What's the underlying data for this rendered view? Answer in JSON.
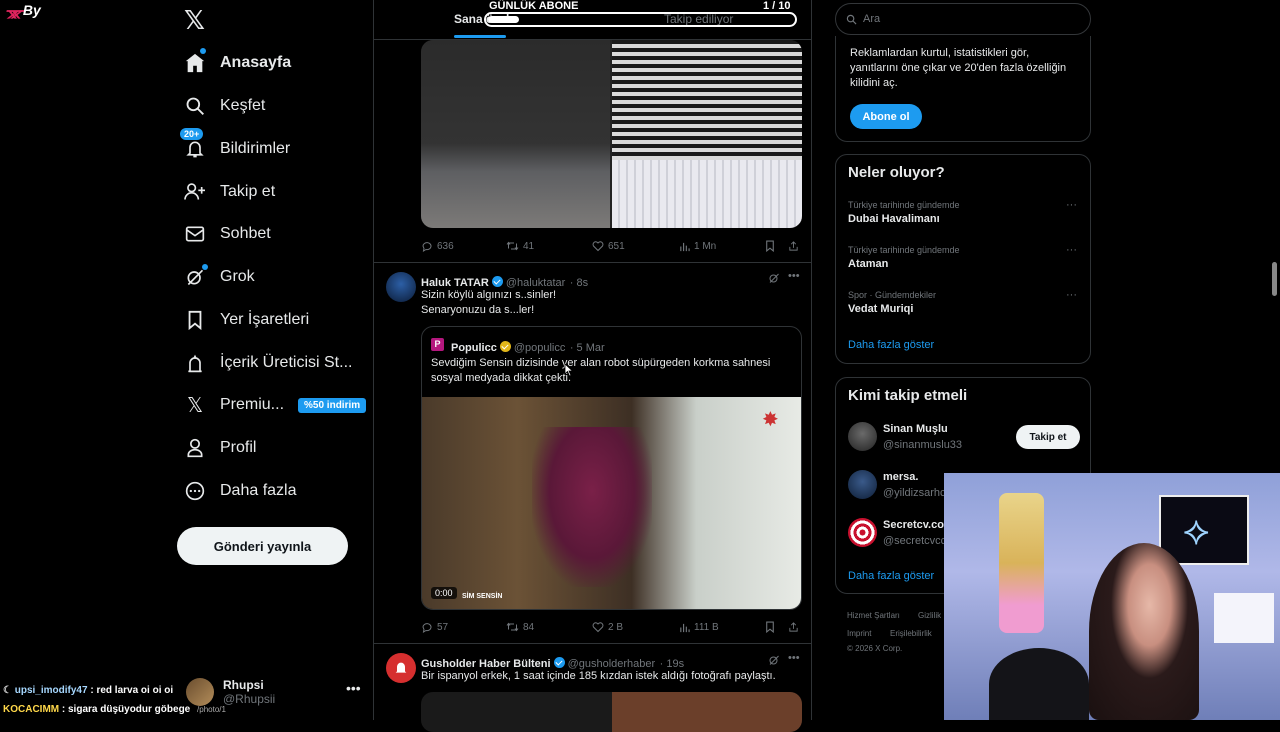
{
  "overlay": {
    "brand": "By",
    "goal_title": "GÜNLÜK ABONE",
    "goal_count": "1  / 10",
    "goal_progress": 0.1,
    "chat": [
      {
        "user": "upsi_imodify47",
        "message": ": red larva oi oi oi"
      },
      {
        "user": "KOCACIMM",
        "message": ": sigara düşüyodur göbege"
      }
    ],
    "status_url": "/photo/1"
  },
  "sidebar": {
    "items": [
      {
        "label": "Anasayfa",
        "icon": "home-icon"
      },
      {
        "label": "Keşfet",
        "icon": "search-icon"
      },
      {
        "label": "Bildirimler",
        "icon": "bell-icon",
        "badge": "20+"
      },
      {
        "label": "Takip et",
        "icon": "follow-icon"
      },
      {
        "label": "Sohbet",
        "icon": "mail-icon"
      },
      {
        "label": "Grok",
        "icon": "grok-icon"
      },
      {
        "label": "Yer İşaretleri",
        "icon": "bookmark-icon"
      },
      {
        "label": "İçerik Üreticisi St...",
        "icon": "creator-icon"
      },
      {
        "label": "Premiu...",
        "icon": "x-premium-icon",
        "badge": "%50 indirim"
      },
      {
        "label": "Profil",
        "icon": "profile-icon"
      },
      {
        "label": "Daha fazla",
        "icon": "more-icon"
      }
    ],
    "post_button": "Gönderi yayınla",
    "account": {
      "name": "Rhupsi",
      "handle": "@Rhupsii"
    }
  },
  "feed": {
    "tabs": [
      "Sana özel",
      "Takip ediliyor"
    ],
    "tweet1_stats": {
      "replies": "636",
      "retweets": "41",
      "likes": "651",
      "views": "1 Mn"
    },
    "tweet2": {
      "name": "Haluk TATAR",
      "handle": "@haluktatar",
      "time": "· 8s",
      "text1": "Sizin köylü algınızı s..sinler!",
      "text2": "Senaryonuzu da s...ler!",
      "quote": {
        "name": "Populicc",
        "handle": "@populicc",
        "time": "· 5 Mar",
        "text1": "Sevdiğim Sensin dizisinde yer alan robot süpürgeden korkma sahnesi",
        "text2": "sosyal medyada dikkat çekti.",
        "video_time": "0:00",
        "video_caption": "SİM SENSİN"
      },
      "stats": {
        "replies": "57",
        "retweets": "84",
        "likes": "2 B",
        "views": "111 B"
      }
    },
    "tweet3": {
      "name": "Gusholder Haber Bülteni",
      "handle": "@gusholderhaber",
      "time": "· 19s",
      "text": "Bir ispanyol erkek, 1 saat içinde 185 kızdan istek aldığı fotoğrafı paylaştı."
    }
  },
  "right": {
    "search_placeholder": "Ara",
    "premium": {
      "text1": "Reklamlardan kurtul, istatistikleri gör,",
      "text2": "yanıtlarını öne çıkar ve 20'den fazla özelliğin",
      "text3": "kilidini aç.",
      "button": "Abone ol"
    },
    "trends_title": "Neler oluyor?",
    "trends": [
      {
        "category": "Türkiye tarihinde gündemde",
        "name": "Dubai Havalimanı"
      },
      {
        "category": "Türkiye tarihinde gündemde",
        "name": "Ataman"
      },
      {
        "category": "Spor · Gündemdekiler",
        "name": "Vedat Muriqi"
      }
    ],
    "trends_more": "Daha fazla göster",
    "wtf_title": "Kimi takip etmeli",
    "wtf": [
      {
        "name": "Sinan Muşlu",
        "handle": "@sinanmuslu33",
        "button": "Takip et"
      },
      {
        "name": "mersa.",
        "handle": "@yildizsarhc"
      },
      {
        "name": "Secretcv.co",
        "handle": "@secretcvcc"
      }
    ],
    "wtf_more": "Daha fazla göster",
    "footer": [
      "Hizmet Şartları",
      "Gizlilik",
      "Imprint",
      "Erişilebilirlik",
      "© 2026 X Corp."
    ]
  },
  "colors": {
    "accent": "#1d9bf0",
    "background": "#000000",
    "border": "#2f3336",
    "muted": "#71767b"
  }
}
